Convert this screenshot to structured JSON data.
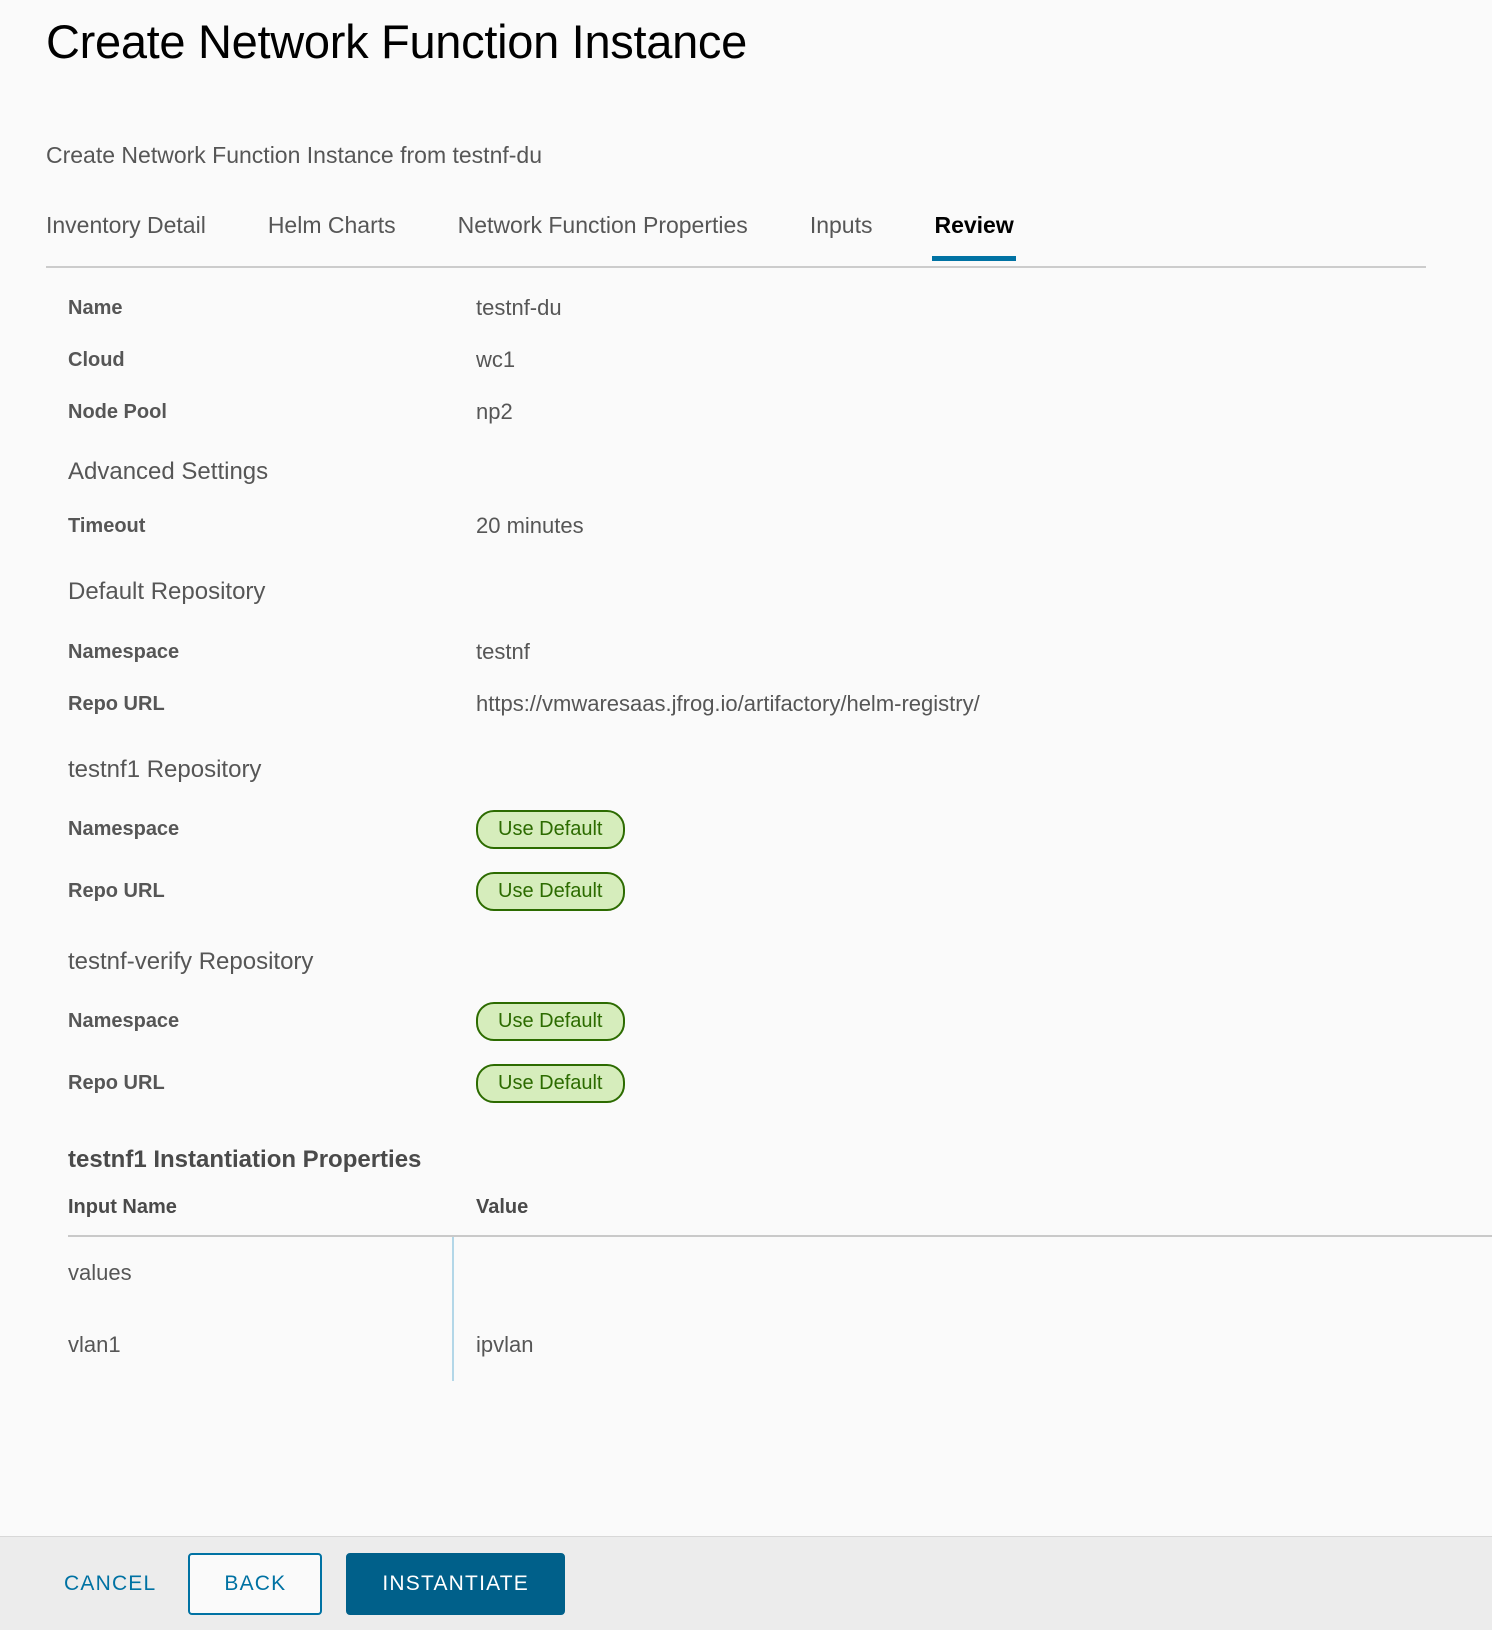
{
  "header": {
    "title": "Create Network Function Instance",
    "subtitle": "Create Network Function Instance from testnf-du"
  },
  "tabs": [
    {
      "label": "Inventory Detail",
      "active": false
    },
    {
      "label": "Helm Charts",
      "active": false
    },
    {
      "label": "Network Function Properties",
      "active": false
    },
    {
      "label": "Inputs",
      "active": false
    },
    {
      "label": "Review",
      "active": true
    }
  ],
  "summary": [
    {
      "label": "Name",
      "value": "testnf-du"
    },
    {
      "label": "Cloud",
      "value": "wc1"
    },
    {
      "label": "Node Pool",
      "value": "np2"
    }
  ],
  "advanced": {
    "heading": "Advanced Settings",
    "rows": [
      {
        "label": "Timeout",
        "value": "20 minutes"
      }
    ]
  },
  "default_repository": {
    "heading": "Default Repository",
    "rows": [
      {
        "label": "Namespace",
        "value": "testnf"
      },
      {
        "label": "Repo URL",
        "value": "https://vmwaresaas.jfrog.io/artifactory/helm-registry/"
      }
    ]
  },
  "testnf1_repository": {
    "heading": "testnf1 Repository",
    "rows": [
      {
        "label": "Namespace",
        "badge": "Use Default"
      },
      {
        "label": "Repo URL",
        "badge": "Use Default"
      }
    ]
  },
  "testnf_verify_repository": {
    "heading": "testnf-verify Repository",
    "rows": [
      {
        "label": "Namespace",
        "badge": "Use Default"
      },
      {
        "label": "Repo URL",
        "badge": "Use Default"
      }
    ]
  },
  "instantiation_properties": {
    "heading": "testnf1 Instantiation Properties",
    "columns": {
      "name": "Input Name",
      "value": "Value"
    },
    "rows": [
      {
        "name": "values",
        "value": ""
      },
      {
        "name": "vlan1",
        "value": "ipvlan"
      }
    ]
  },
  "footer": {
    "cancel": "CANCEL",
    "back": "BACK",
    "instantiate": "INSTANTIATE"
  },
  "colors": {
    "accent": "#0072a3",
    "primary_button": "#00608a",
    "badge_text": "#2c6b00",
    "badge_fill": "#d6edbc",
    "page_background": "#fafafa",
    "footer_background": "#ececec"
  }
}
